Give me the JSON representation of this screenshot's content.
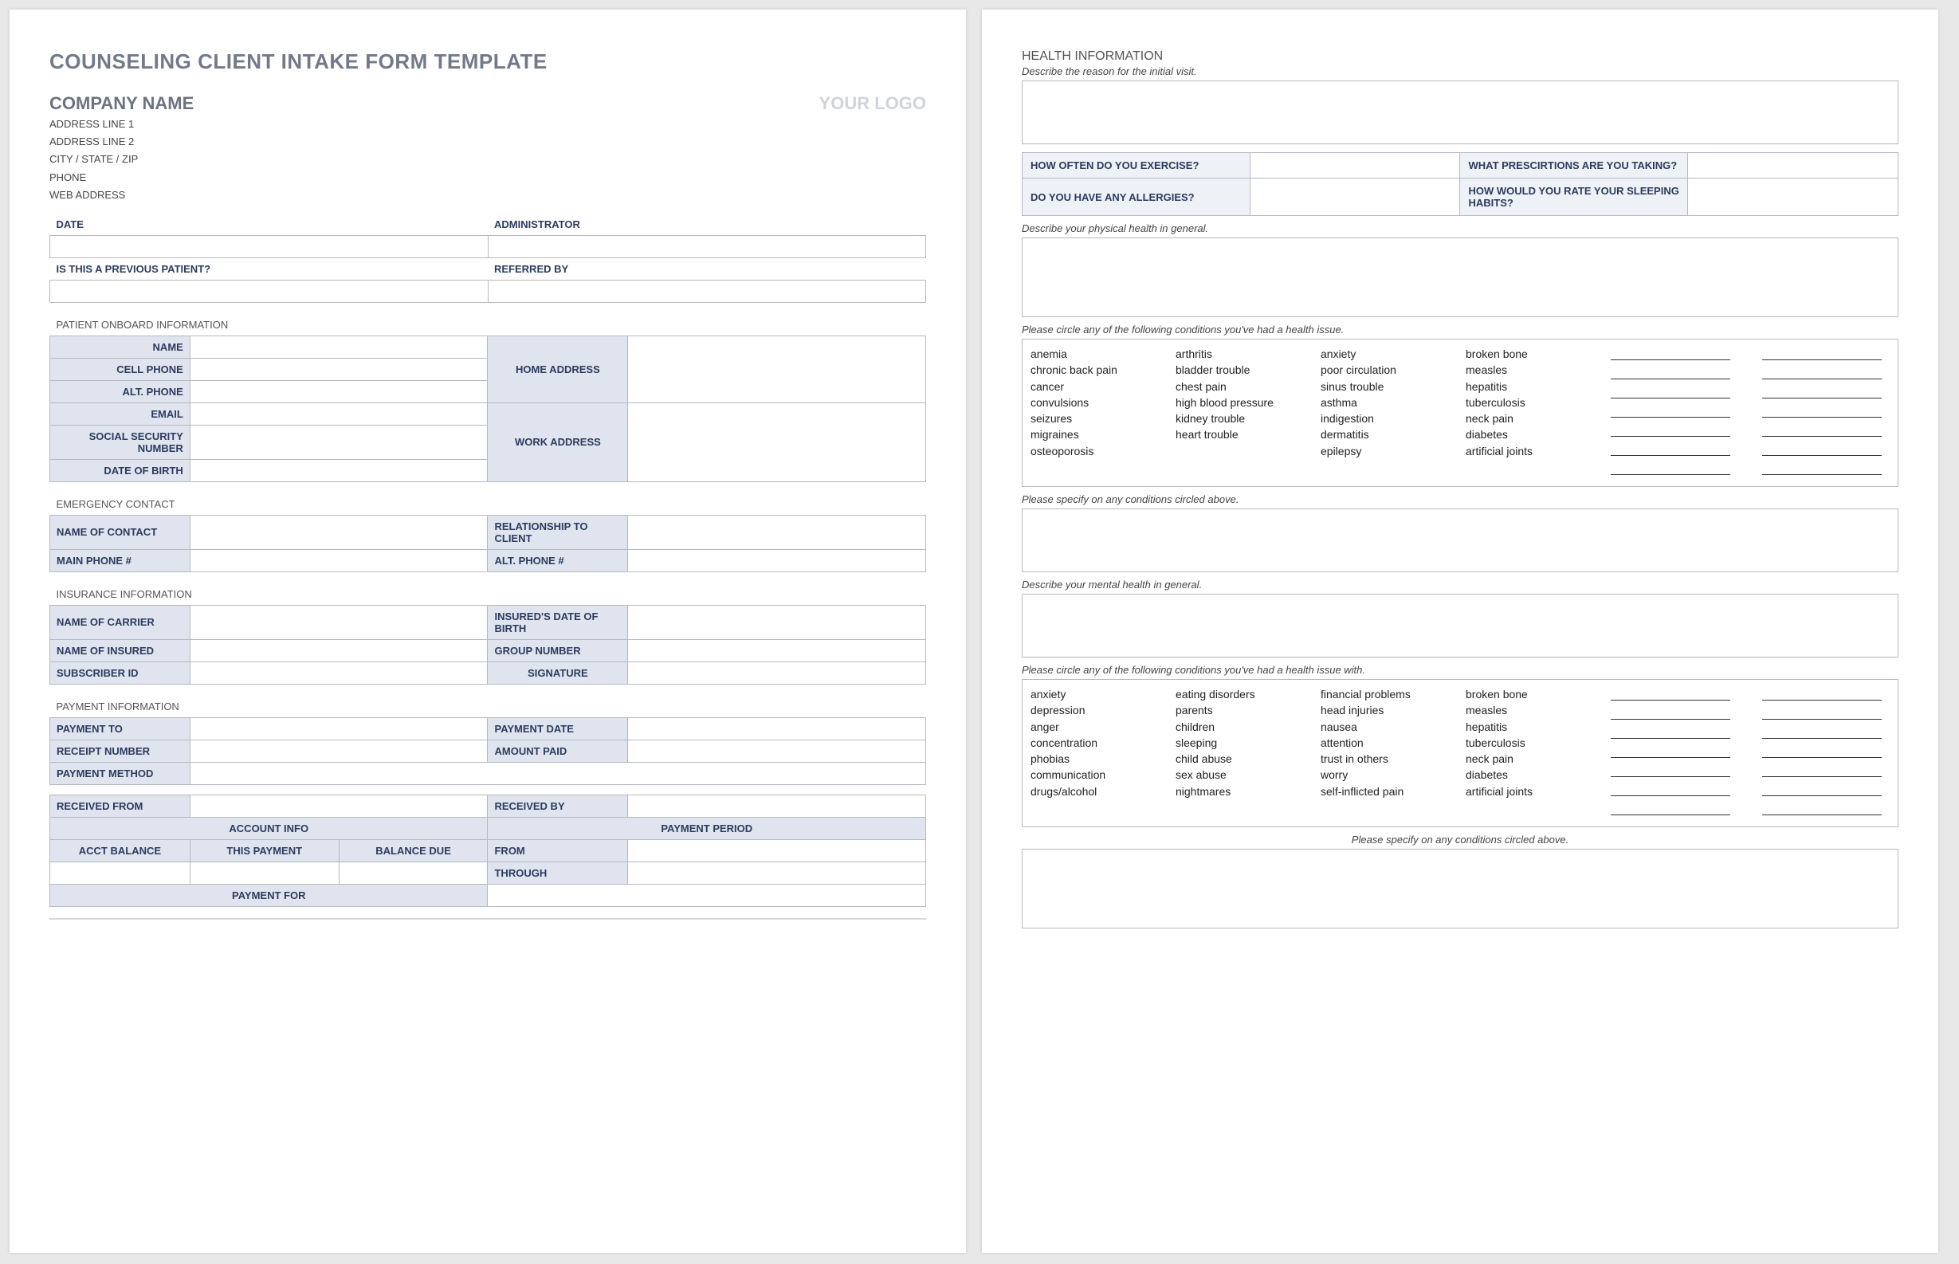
{
  "title": "COUNSELING CLIENT INTAKE FORM TEMPLATE",
  "company": {
    "name": "COMPANY NAME",
    "addr1": "ADDRESS LINE 1",
    "addr2": "ADDRESS LINE 2",
    "csz": "CITY / STATE / ZIP",
    "phone": "PHONE",
    "web": "WEB ADDRESS"
  },
  "logo": "YOUR LOGO",
  "labels": {
    "date": "DATE",
    "admin": "ADMINISTRATOR",
    "prev": "IS THIS A PREVIOUS PATIENT?",
    "refby": "REFERRED BY",
    "patient_h": "PATIENT ONBOARD INFORMATION",
    "name": "NAME",
    "cell": "CELL PHONE",
    "alt": "ALT. PHONE",
    "email": "EMAIL",
    "ssn": "SOCIAL SECURITY NUMBER",
    "dob": "DATE OF BIRTH",
    "homeaddr": "HOME ADDRESS",
    "workaddr": "WORK ADDRESS",
    "emer_h": "EMERGENCY CONTACT",
    "ec_name": "NAME OF CONTACT",
    "ec_rel": "RELATIONSHIP TO CLIENT",
    "ec_main": "MAIN PHONE #",
    "ec_alt": "ALT. PHONE #",
    "ins_h": "INSURANCE INFORMATION",
    "ins_carrier": "NAME OF CARRIER",
    "ins_dob": "INSURED'S DATE OF BIRTH",
    "ins_name": "NAME OF INSURED",
    "ins_group": "GROUP NUMBER",
    "ins_sub": "SUBSCRIBER ID",
    "ins_sig": "SIGNATURE",
    "pay_h": "PAYMENT INFORMATION",
    "pay_to": "PAYMENT TO",
    "pay_date": "PAYMENT DATE",
    "pay_rec": "RECEIPT NUMBER",
    "pay_amt": "AMOUNT PAID",
    "pay_method": "PAYMENT METHOD",
    "pay_from": "RECEIVED FROM",
    "pay_by": "RECEIVED BY",
    "acct_info": "ACCOUNT INFO",
    "pay_period": "PAYMENT PERIOD",
    "acct_bal": "ACCT BALANCE",
    "this_pay": "THIS PAYMENT",
    "bal_due": "BALANCE DUE",
    "from": "FROM",
    "through": "THROUGH",
    "pay_for": "PAYMENT FOR"
  },
  "p2": {
    "title": "HEALTH INFORMATION",
    "reason": "Describe the reason for the initial visit.",
    "q1": "HOW OFTEN DO YOU EXERCISE?",
    "q2": "WHAT PRESCIRTIONS ARE YOU TAKING?",
    "q3": "DO YOU HAVE ANY ALLERGIES?",
    "q4": "HOW WOULD YOU RATE YOUR SLEEPING HABITS?",
    "phys_desc": "Describe your physical health in general.",
    "circle1": "Please circle any of the following conditions you've had a health issue.",
    "specify1": "Please specify on any conditions circled above.",
    "mental_desc": "Describe your mental health in general.",
    "circle2": "Please circle any of the following conditions you've had a health issue with.",
    "specify2": "Please specify on any conditions circled above.",
    "phys_cols": [
      [
        "anemia",
        "chronic back pain",
        "cancer",
        "convulsions",
        "seizures",
        "migraines",
        "osteoporosis"
      ],
      [
        "arthritis",
        "bladder trouble",
        "chest pain",
        "high blood pressure",
        "kidney trouble",
        "heart trouble"
      ],
      [
        "anxiety",
        "poor circulation",
        "sinus trouble",
        "asthma",
        "indigestion",
        "dermatitis",
        "epilepsy"
      ],
      [
        "broken bone",
        "measles",
        "hepatitis",
        "tuberculosis",
        "neck pain",
        "diabetes",
        "artificial joints"
      ]
    ],
    "mental_cols": [
      [
        "anxiety",
        "depression",
        "anger",
        "concentration",
        "phobias",
        "communication",
        "drugs/alcohol"
      ],
      [
        "eating disorders",
        "parents",
        "children",
        "sleeping",
        "child abuse",
        "sex abuse",
        "nightmares"
      ],
      [
        "financial problems",
        "head injuries",
        "nausea",
        "attention",
        "trust in others",
        "worry",
        "self-inflicted pain"
      ],
      [
        "broken bone",
        "measles",
        "hepatitis",
        "tuberculosis",
        "neck pain",
        "diabetes",
        "artificial joints"
      ]
    ]
  }
}
